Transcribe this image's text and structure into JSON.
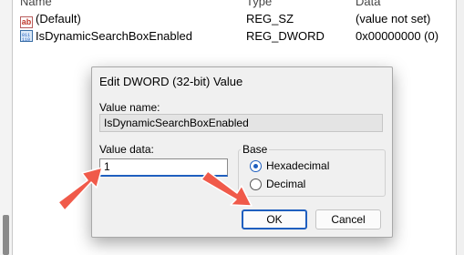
{
  "table": {
    "headers": [
      "Name",
      "Type",
      "Data"
    ],
    "rows": [
      {
        "name": "(Default)",
        "type": "REG_SZ",
        "data": "(value not set)",
        "icon": "string-value-icon"
      },
      {
        "name": "IsDynamicSearchBoxEnabled",
        "type": "REG_DWORD",
        "data": "0x00000000 (0)",
        "icon": "binary-value-icon"
      }
    ]
  },
  "dialog": {
    "title": "Edit DWORD (32-bit) Value",
    "value_name_label": "Value name:",
    "value_name": "IsDynamicSearchBoxEnabled",
    "value_data_label": "Value data:",
    "value_data": "1",
    "base_label": "Base",
    "base_options": [
      {
        "label": "Hexadecimal",
        "selected": true
      },
      {
        "label": "Decimal",
        "selected": false
      }
    ],
    "ok_label": "OK",
    "cancel_label": "Cancel"
  },
  "colors": {
    "accent": "#1f5fbf",
    "annotation_arrow": "#f05a4a"
  }
}
